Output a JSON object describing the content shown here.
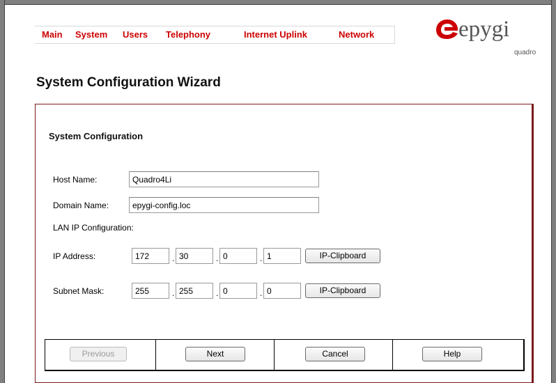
{
  "nav": {
    "items": [
      {
        "label": "Main"
      },
      {
        "label": "System"
      },
      {
        "label": "Users"
      },
      {
        "label": "Telephony"
      },
      {
        "label": "Internet Uplink"
      },
      {
        "label": "Network"
      }
    ]
  },
  "logo": {
    "brand": "epygi",
    "sub": "quadro",
    "icon": "epygi-logo-mark",
    "color": "#cc0000"
  },
  "page": {
    "title": "System Configuration Wizard"
  },
  "section": {
    "title": "System Configuration"
  },
  "form": {
    "host_name_label": "Host Name:",
    "host_name_value": "Quadro4Li",
    "domain_name_label": "Domain Name:",
    "domain_name_value": "epygi-config.loc",
    "lan_ip_label": "LAN IP Configuration:",
    "ip_address_label": "IP Address:",
    "ip_address": [
      "172",
      "30",
      "0",
      "1"
    ],
    "subnet_mask_label": "Subnet Mask:",
    "subnet_mask": [
      "255",
      "255",
      "0",
      "0"
    ],
    "dot": ".",
    "clipboard_label": "IP-Clipboard"
  },
  "buttons": {
    "previous": "Previous",
    "next": "Next",
    "cancel": "Cancel",
    "help": "Help"
  },
  "colors": {
    "nav_text": "#cc0000",
    "panel_border": "#7a1a1a"
  }
}
